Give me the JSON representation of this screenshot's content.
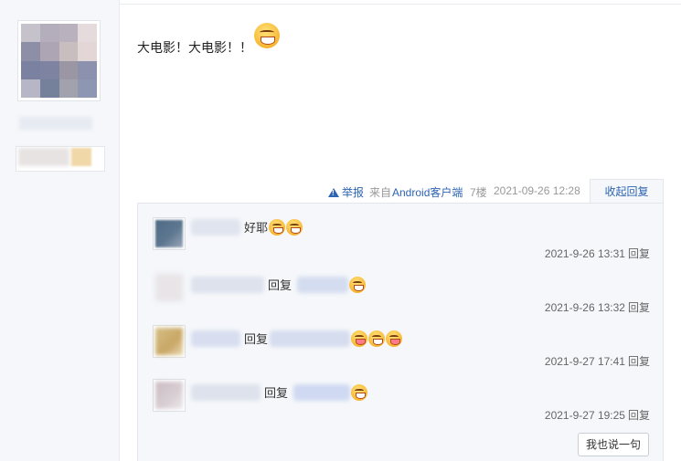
{
  "post": {
    "text": "大电影！大电影！！",
    "report_label": "举报",
    "source_prefix": "来自",
    "source_link": "Android客户端",
    "floor": "7楼",
    "time": "2021-09-26 12:28",
    "collapse_label": "收起回复"
  },
  "replies": [
    {
      "content": "好耶",
      "time": "2021-9-26 13:31",
      "reply_btn": "回复"
    },
    {
      "reply_word": "回复",
      "time": "2021-9-26 13:32",
      "reply_btn": "回复"
    },
    {
      "reply_word": "回复",
      "time": "2021-9-27 17:41",
      "reply_btn": "回复"
    },
    {
      "reply_word": "回复",
      "time": "2021-9-27 19:25",
      "reply_btn": "回复"
    }
  ],
  "say_button": "我也说一句",
  "colors": {
    "link": "#2d64b3",
    "panel_bg": "#f5f7fa",
    "border": "#e3e7ec"
  },
  "icons": [
    "warning-icon",
    "grin-emoji",
    "tongue-emoji"
  ]
}
